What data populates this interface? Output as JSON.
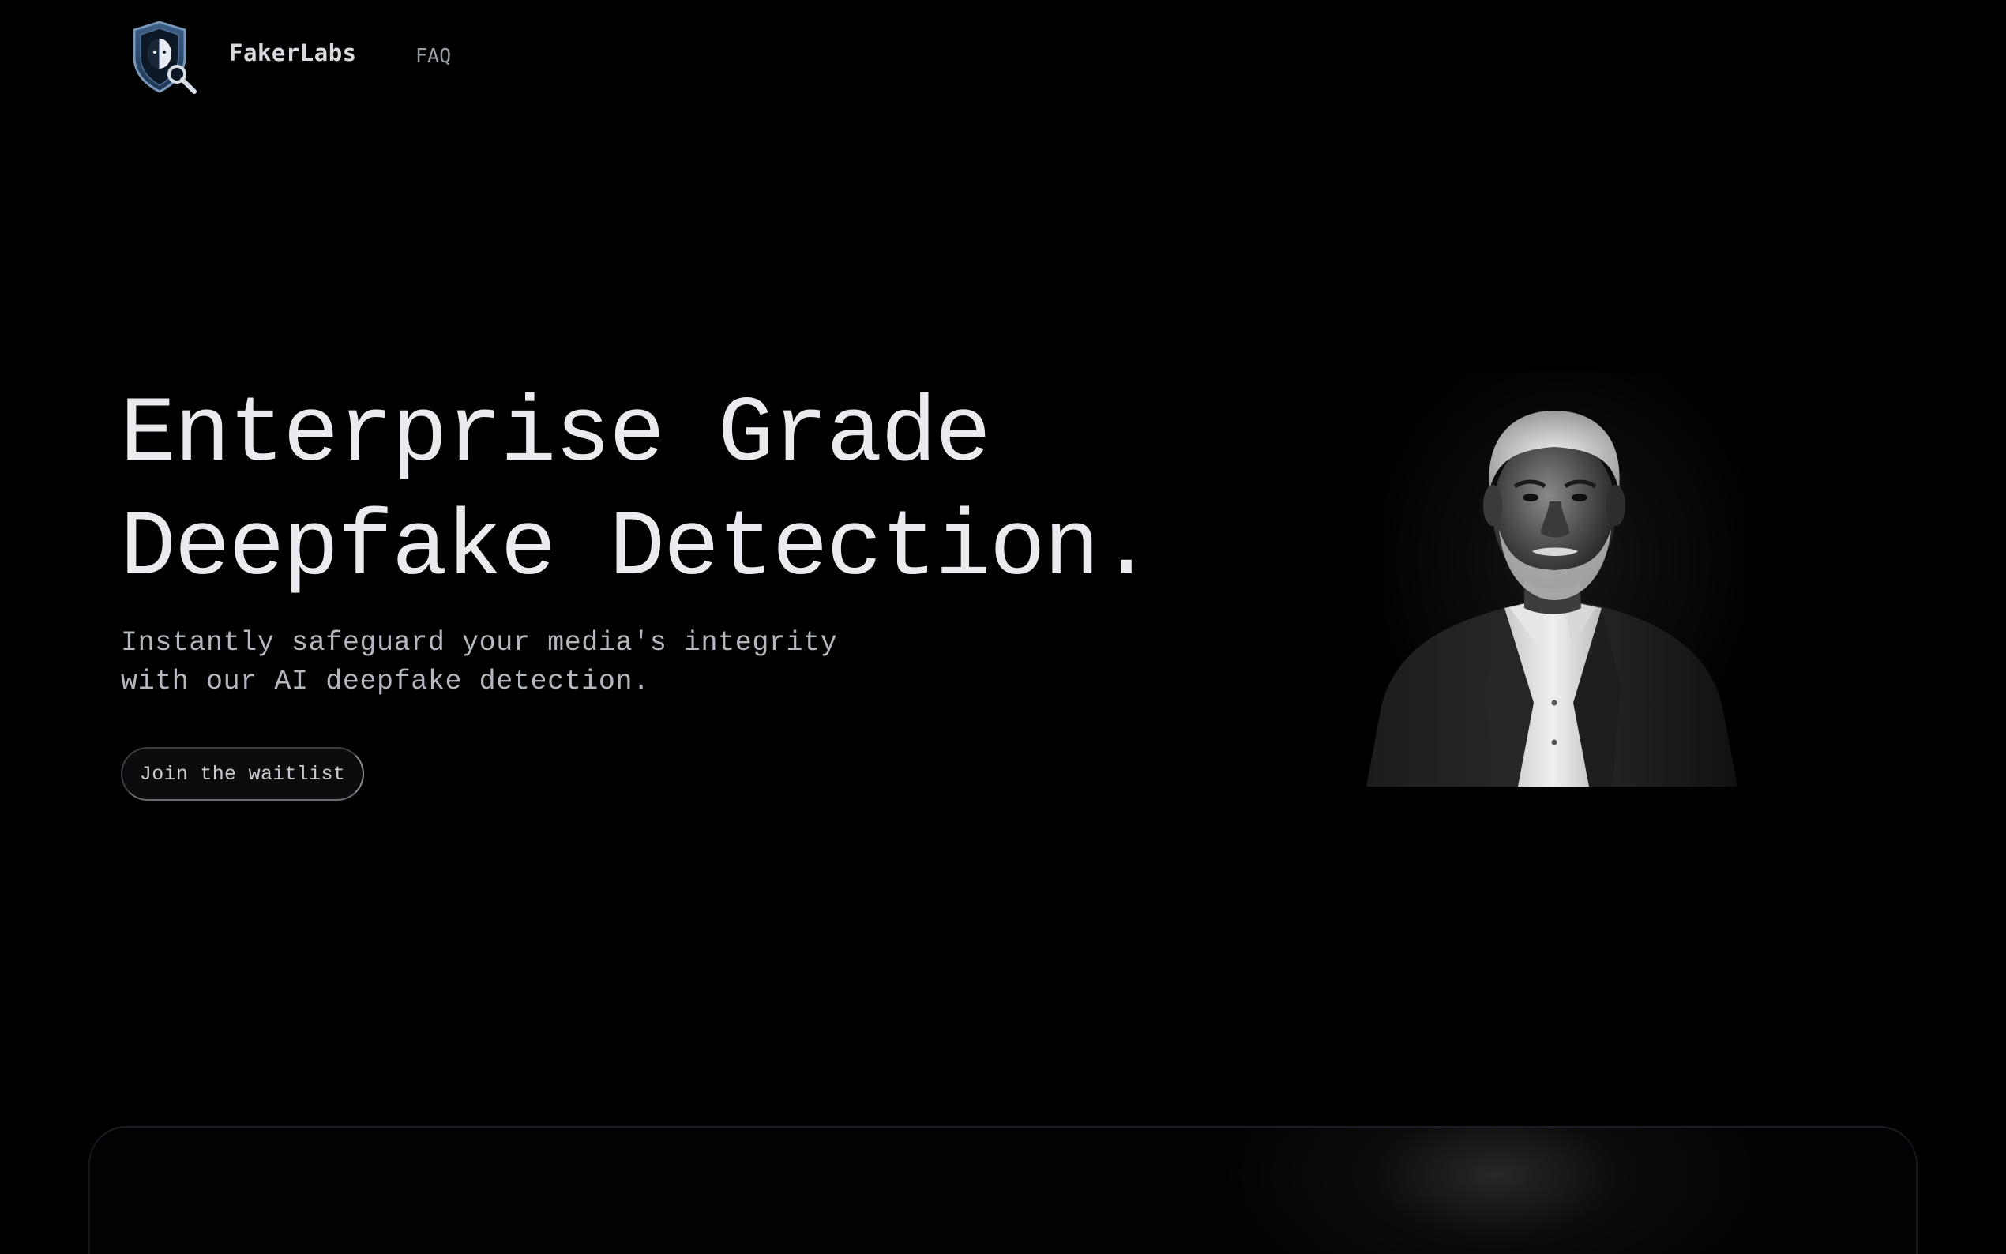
{
  "header": {
    "brand": "FakerLabs",
    "nav": {
      "faq_label": "FAQ"
    },
    "logo_icon": "shield-magnifier-icon"
  },
  "hero": {
    "title_line1": "Enterprise Grade",
    "title_line2": "Deepfake Detection.",
    "subtitle_line1": "Instantly safeguard your media's integrity",
    "subtitle_line2": "with our AI deepfake detection.",
    "cta_label": "Join the waitlist",
    "portrait_alt": "black-and-white portrait of a man"
  },
  "colors": {
    "background": "#000000",
    "title": "#e9ebef",
    "subtitle": "#b4b8be",
    "nav_muted": "#9aa0a8",
    "button_bg": "#0b0c0e"
  }
}
